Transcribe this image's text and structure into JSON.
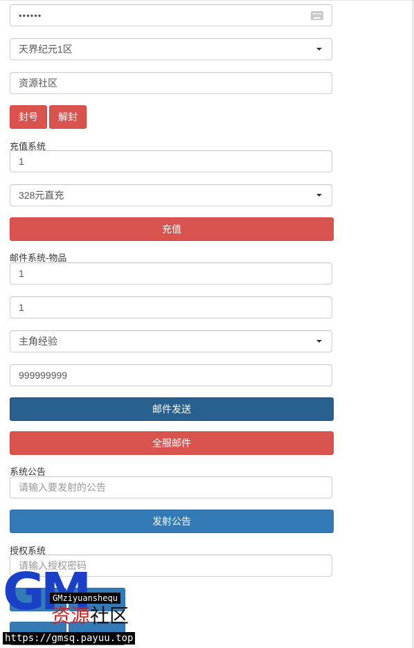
{
  "account": {
    "password_value": "••••••",
    "server_select": "天界纪元1区",
    "community_value": "资源社区",
    "ban_label": "封号",
    "unban_label": "解封"
  },
  "recharge": {
    "section_label": "充值系统",
    "amount_value": "1",
    "package_select": "328元直充",
    "submit_label": "充值"
  },
  "mail": {
    "section_label": "邮件系统-物品",
    "field1_value": "1",
    "field2_value": "1",
    "item_select": "主角经验",
    "quantity_value": "999999999",
    "send_label": "邮件发送",
    "send_all_label": "全服邮件"
  },
  "announce": {
    "section_label": "系统公告",
    "placeholder": "请输入要发射的公告",
    "submit_label": "发射公告"
  },
  "auth": {
    "section_label": "授权系统",
    "placeholder": "请输入授权密码"
  },
  "watermark": {
    "logo_letters": "GM",
    "tag": "GMziyuanshequ",
    "cn_red": "资源",
    "cn_black": "社区",
    "url": "https://gmsq.payuu.top"
  }
}
